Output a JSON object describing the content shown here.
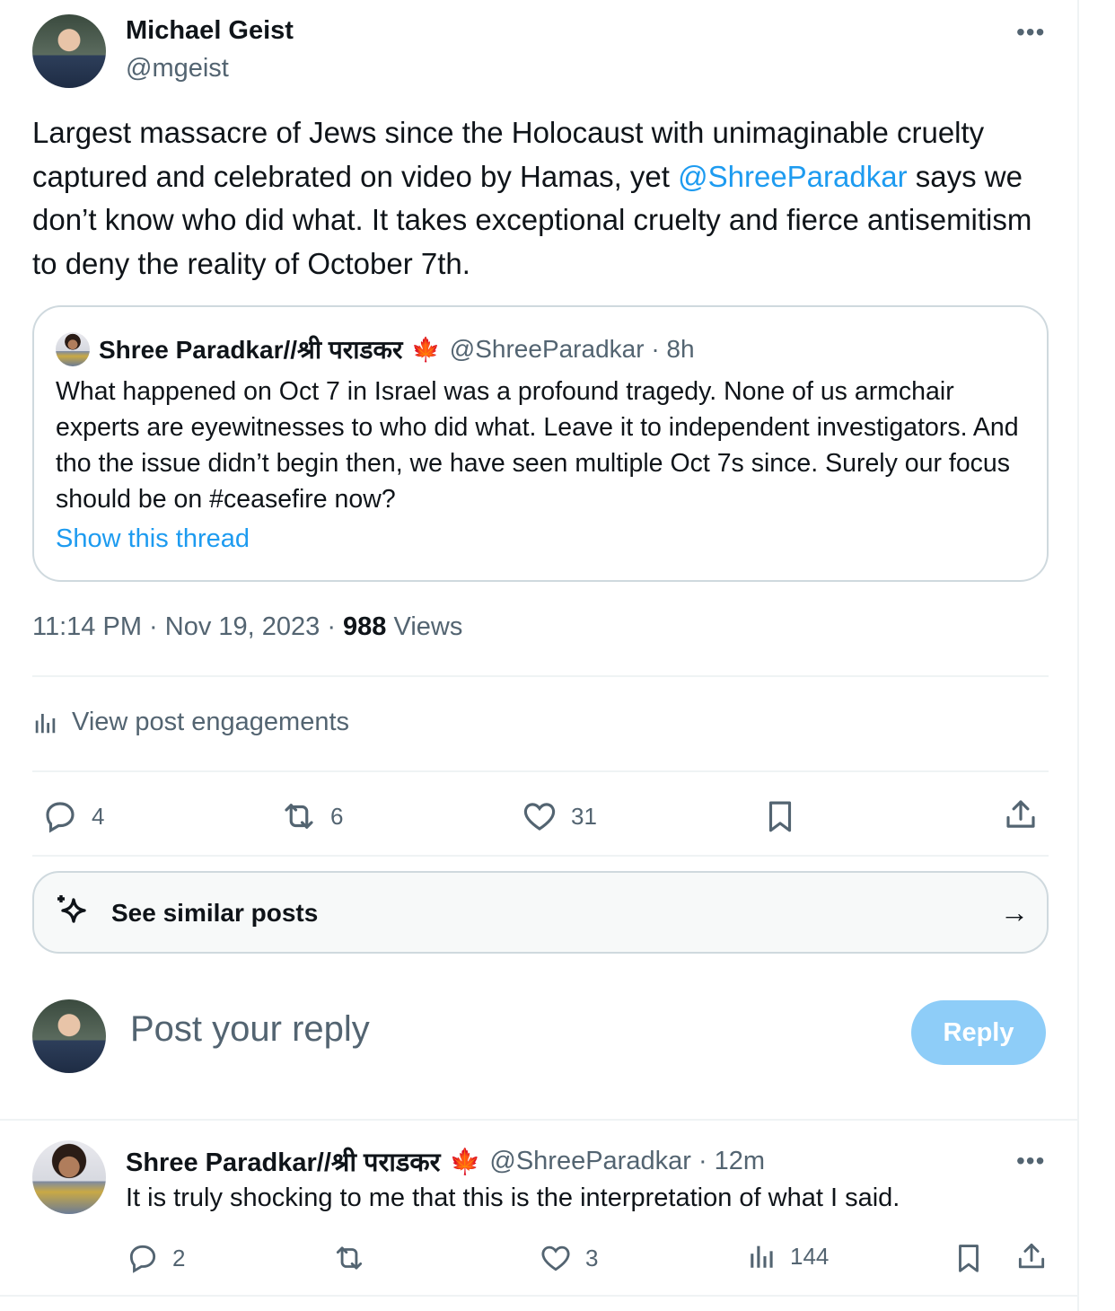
{
  "main_post": {
    "author_name": "Michael Geist",
    "author_handle": "@mgeist",
    "text_before_mention": "Largest massacre of Jews since the Holocaust with unimaginable cruelty captured and celebrated on video by Hamas, yet ",
    "mention": "@ShreeParadkar",
    "text_after_mention": " says we don’t know who did what. It takes exceptional cruelty and fierce antisemitism to deny the reality of October 7th.",
    "more_icon": "more-dots-icon",
    "timestamp": "11:14 PM · Nov 19, 2023 · ",
    "views_count": "988",
    "views_label": "Views",
    "engagements_label": "View post engagements",
    "replies": "4",
    "reposts": "6",
    "likes": "31"
  },
  "quoted_post": {
    "author_name": "Shree Paradkar//श्री पराडकर",
    "flag": "🍁",
    "meta": "@ShreeParadkar · 8h",
    "text": "What happened on Oct 7 in Israel was a profound tragedy. None of us armchair experts are eyewitnesses to who did what. Leave it to independent investigators. And tho the issue didn’t begin then, we have seen multiple Oct 7s since. Surely our focus should be on  #ceasefire now?",
    "show_thread": "Show this thread"
  },
  "similar_posts": {
    "label": "See similar posts",
    "arrow": "→"
  },
  "composer": {
    "placeholder": "Post your reply",
    "button_label": "Reply"
  },
  "reply_post": {
    "author_name": "Shree Paradkar//श्री पराडकर",
    "flag": "🍁",
    "meta": "@ShreeParadkar · 12m",
    "text": "It is truly shocking to me that this is the interpretation of what I said.",
    "replies": "2",
    "reposts": "",
    "likes": "3",
    "views": "144"
  },
  "colors": {
    "accent": "#1d9bf0",
    "secondary_text": "#536471",
    "border": "#cfd9de",
    "reply_button": "#8ecdf8"
  }
}
